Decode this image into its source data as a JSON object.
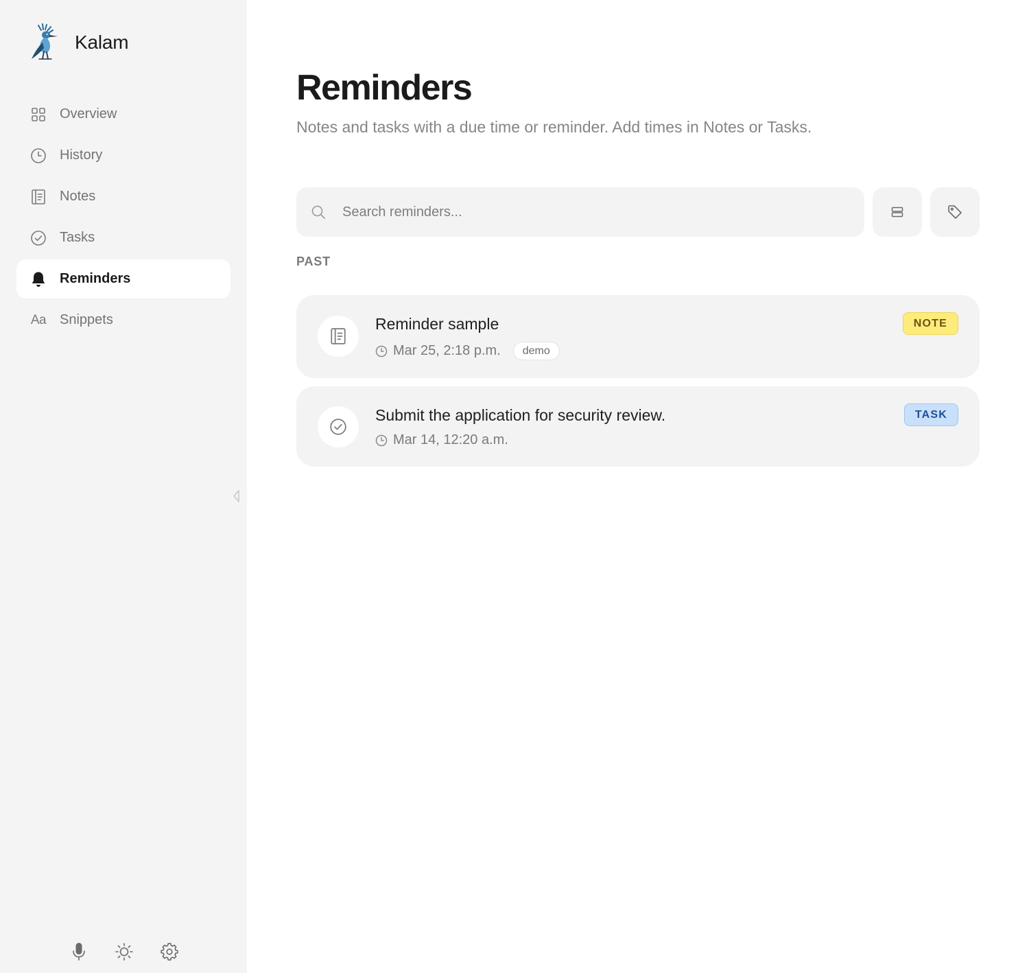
{
  "app": {
    "name": "Kalam"
  },
  "sidebar": {
    "items": [
      {
        "label": "Overview",
        "icon": "grid-icon",
        "active": false
      },
      {
        "label": "History",
        "icon": "clock-icon",
        "active": false
      },
      {
        "label": "Notes",
        "icon": "notes-icon",
        "active": false
      },
      {
        "label": "Tasks",
        "icon": "check-circle-icon",
        "active": false
      },
      {
        "label": "Reminders",
        "icon": "bell-icon",
        "active": true
      },
      {
        "label": "Snippets",
        "icon": "text-aa-icon",
        "glyph": "Aa",
        "active": false
      }
    ],
    "footer_icons": [
      "microphone-icon",
      "sun-icon",
      "gear-icon"
    ]
  },
  "page": {
    "title": "Reminders",
    "subtitle": "Notes and tasks with a due time or reminder. Add times in Notes or Tasks."
  },
  "search": {
    "placeholder": "Search reminders...",
    "value": ""
  },
  "toolbar": {
    "buttons": [
      "stack-icon",
      "tag-icon"
    ]
  },
  "section": {
    "label": "PAST"
  },
  "reminders": [
    {
      "title": "Reminder sample",
      "time": "Mar 25, 2:18 p.m.",
      "tag": "demo",
      "type": "NOTE",
      "icon": "notes-icon"
    },
    {
      "title": "Submit the application for security review.",
      "time": "Mar 14, 12:20 a.m.",
      "tag": null,
      "type": "TASK",
      "icon": "check-circle-icon"
    }
  ],
  "colors": {
    "sidebar_bg": "#f4f4f5",
    "card_bg": "#f3f3f4",
    "note_badge": "#fdec7a",
    "task_badge": "#c9e0fb",
    "text_primary": "#1b1b1b",
    "text_muted": "#858585"
  }
}
